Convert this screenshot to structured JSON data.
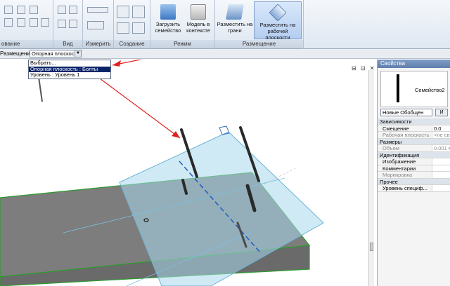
{
  "ribbon": {
    "panels": [
      {
        "label": "ование"
      },
      {
        "label": "Вид"
      },
      {
        "label": "Измерить"
      },
      {
        "label": "Создание"
      },
      {
        "label": "Режим"
      },
      {
        "label": "Размещение"
      }
    ],
    "buttons": {
      "load_family": "Загрузить семейство",
      "model_in_context": "Модель в контексте",
      "place_on_face": "Разместить на грани",
      "place_on_workplane": "Разместить на рабочей плоскости"
    }
  },
  "options_bar": {
    "label": "Размещение:",
    "selected_value": "Опорная плоскос"
  },
  "dropdown": {
    "items": [
      "Выбрать...",
      "Опорная плоскость : Болты",
      "Уровень : Уровень 1"
    ],
    "selected_index": 1
  },
  "view": {
    "controls": "⊟ ⊡ ✕",
    "scrollbar_position": 0.85
  },
  "properties": {
    "title": "Свойства",
    "family_name": "Семейство2",
    "type_selector": "Новые Обобщен",
    "edit_type_label": "И",
    "rows": [
      {
        "group": true,
        "label": "Зависимости"
      },
      {
        "label": "Смещение",
        "value": "0.0"
      },
      {
        "label": "Рабочая плоскость",
        "value": "<не св",
        "gray": true
      },
      {
        "group": true,
        "label": "Размеры"
      },
      {
        "label": "Объем",
        "value": "0.001 м",
        "gray": true
      },
      {
        "group": true,
        "label": "Идентификация"
      },
      {
        "label": "Изображение",
        "value": ""
      },
      {
        "label": "Комментарии",
        "value": ""
      },
      {
        "label": "Маркировка",
        "value": "",
        "gray": true
      },
      {
        "group": true,
        "label": "Прочее"
      },
      {
        "label": "Уровень специф...",
        "value": ""
      }
    ]
  },
  "colors": {
    "annotation_arrow": "#e02020",
    "plane_fill": "#a8d8ec",
    "slab_top": "#7f7f7f",
    "slab_edge": "#2e9b2e",
    "ribbon_active": "#b4cdf0"
  }
}
